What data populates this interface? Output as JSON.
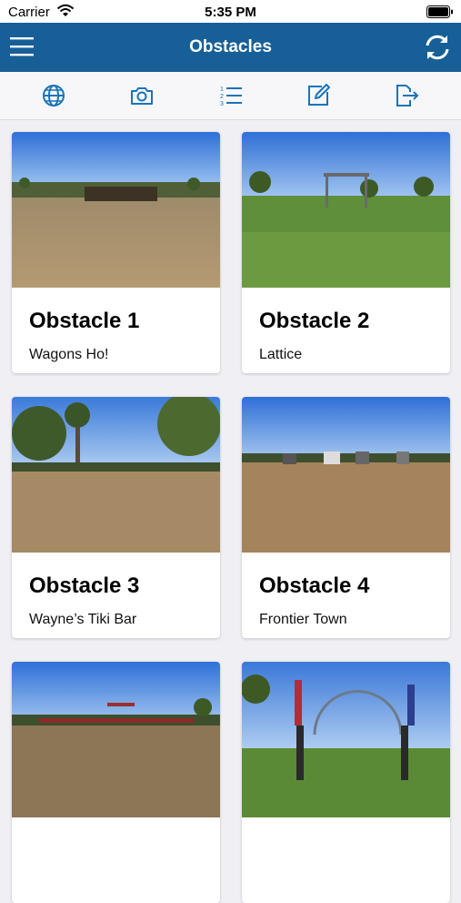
{
  "status": {
    "carrier": "Carrier",
    "time": "5:35 PM"
  },
  "header": {
    "title": "Obstacles",
    "menu_icon": "menu-icon",
    "refresh_icon": "refresh-icon"
  },
  "toolbar": {
    "icons": [
      "globe-icon",
      "camera-icon",
      "numbered-list-icon",
      "edit-icon",
      "export-icon"
    ]
  },
  "colors": {
    "nav": "#175f97",
    "accent": "#1a73b8",
    "background": "#efeff4"
  },
  "obstacles": [
    {
      "name": "Obstacle 1",
      "subtitle": "Wagons Ho!"
    },
    {
      "name": "Obstacle 2",
      "subtitle": "Lattice"
    },
    {
      "name": "Obstacle 3",
      "subtitle": "Wayne’s Tiki Bar"
    },
    {
      "name": "Obstacle 4",
      "subtitle": "Frontier Town"
    },
    {
      "name": "",
      "subtitle": ""
    },
    {
      "name": "",
      "subtitle": ""
    }
  ]
}
